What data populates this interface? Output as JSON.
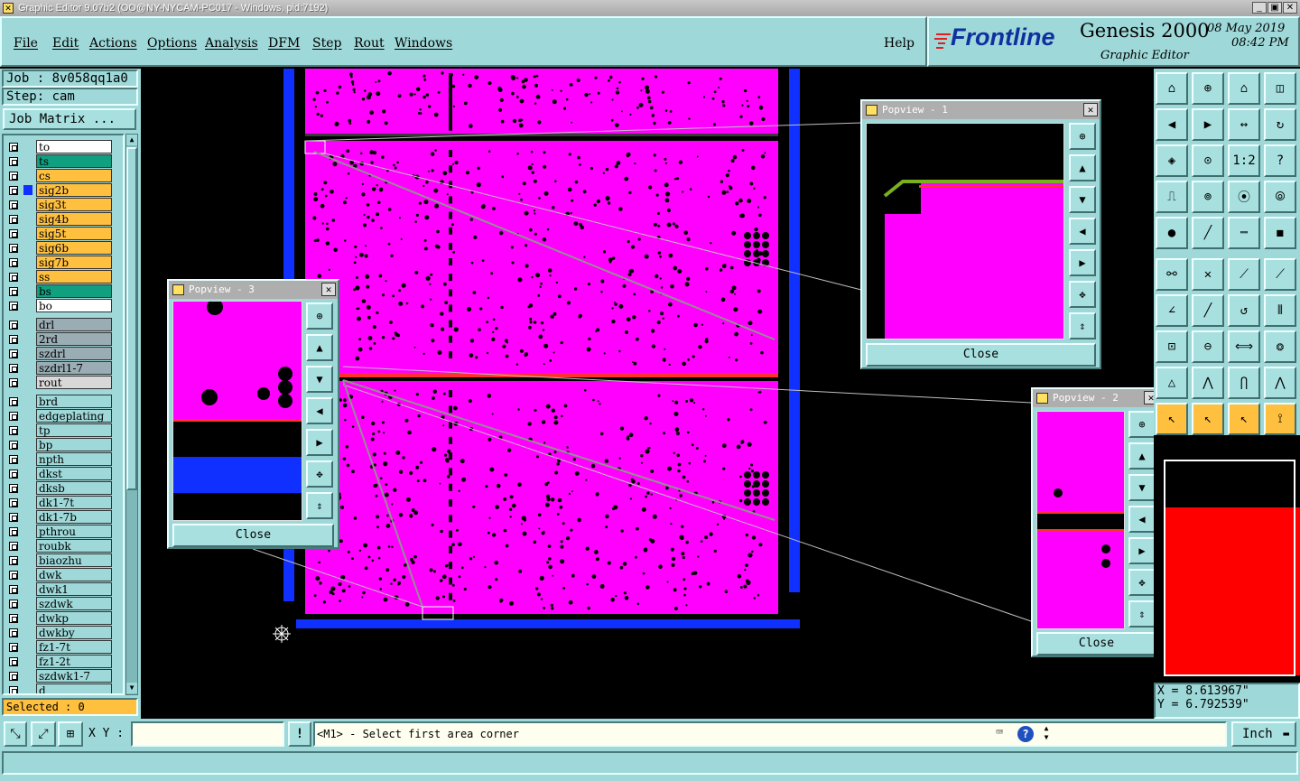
{
  "window": {
    "title": "Graphic Editor 9.07b2 (OO@NY-NYCAM-PC017 - Windows, pid:7192)"
  },
  "menu": {
    "file": "File",
    "edit": "Edit",
    "actions": "Actions",
    "options": "Options",
    "analysis": "Analysis",
    "dfm": "DFM",
    "step": "Step",
    "rout": "Rout",
    "windows": "Windows",
    "help": "Help"
  },
  "brand": {
    "logo": "Frontline",
    "product": "Genesis 2000",
    "subtitle": "Graphic Editor",
    "date": "08 May 2019",
    "time": "08:42 PM"
  },
  "job": {
    "job_label": "Job : 8v058qq1a0",
    "step_label": "Step: cam",
    "matrix_button": "Job Matrix ..."
  },
  "layers": [
    {
      "name": "to",
      "color": "#ffffff"
    },
    {
      "name": "ts",
      "color": "#10a080"
    },
    {
      "name": "cs",
      "color": "#ffc040"
    },
    {
      "name": "sig2b",
      "color": "#ffc040"
    },
    {
      "name": "sig3t",
      "color": "#ffc040"
    },
    {
      "name": "sig4b",
      "color": "#ffc040"
    },
    {
      "name": "sig5t",
      "color": "#ffc040"
    },
    {
      "name": "sig6b",
      "color": "#ffc040"
    },
    {
      "name": "sig7b",
      "color": "#ffc040"
    },
    {
      "name": "ss",
      "color": "#ffc040"
    },
    {
      "name": "bs",
      "color": "#10a080"
    },
    {
      "name": "bo",
      "color": "#ffffff"
    },
    {
      "name": "drl",
      "color": "#9aacb4"
    },
    {
      "name": "2rd",
      "color": "#9aacb4"
    },
    {
      "name": "szdrl",
      "color": "#9aacb4"
    },
    {
      "name": "szdrl1-7",
      "color": "#9aacb4"
    },
    {
      "name": "rout",
      "color": "#d8d8d8"
    },
    {
      "name": "brd",
      "color": "#9ed8d8"
    },
    {
      "name": "edgeplating",
      "color": "#9ed8d8"
    },
    {
      "name": "tp",
      "color": "#9ed8d8"
    },
    {
      "name": "bp",
      "color": "#9ed8d8"
    },
    {
      "name": "npth",
      "color": "#9ed8d8"
    },
    {
      "name": "dkst",
      "color": "#9ed8d8"
    },
    {
      "name": "dksb",
      "color": "#9ed8d8"
    },
    {
      "name": "dk1-7t",
      "color": "#9ed8d8"
    },
    {
      "name": "dk1-7b",
      "color": "#9ed8d8"
    },
    {
      "name": "pthrou",
      "color": "#9ed8d8"
    },
    {
      "name": "roubk",
      "color": "#9ed8d8"
    },
    {
      "name": "biaozhu",
      "color": "#9ed8d8"
    },
    {
      "name": "dwk",
      "color": "#9ed8d8"
    },
    {
      "name": "dwk1",
      "color": "#9ed8d8"
    },
    {
      "name": "szdwk",
      "color": "#9ed8d8"
    },
    {
      "name": "dwkp",
      "color": "#9ed8d8"
    },
    {
      "name": "dwkby",
      "color": "#9ed8d8"
    },
    {
      "name": "fz1-7t",
      "color": "#9ed8d8"
    },
    {
      "name": "fz1-2t",
      "color": "#9ed8d8"
    },
    {
      "name": "szdwk1-7",
      "color": "#9ed8d8"
    },
    {
      "name": "d",
      "color": "#9ed8d8"
    }
  ],
  "selected": "Selected : 0",
  "popviews": {
    "p1": {
      "title": "Popview - 1",
      "close": "Close"
    },
    "p2": {
      "title": "Popview - 2",
      "close": "Close"
    },
    "p3": {
      "title": "Popview - 3",
      "close": "Close"
    }
  },
  "coords": {
    "x": "X = 8.613967\"",
    "y": "Y = 6.792539\""
  },
  "status": {
    "xy_label": "X Y :",
    "xy_value": "",
    "prompt": "<M1> - Select first area corner",
    "units": "Inch",
    "excl": "!"
  },
  "colors": {
    "board": "#ff00ff",
    "frame": "#1030ff",
    "panel": "#9ed8d8",
    "canvas": "#000000"
  }
}
